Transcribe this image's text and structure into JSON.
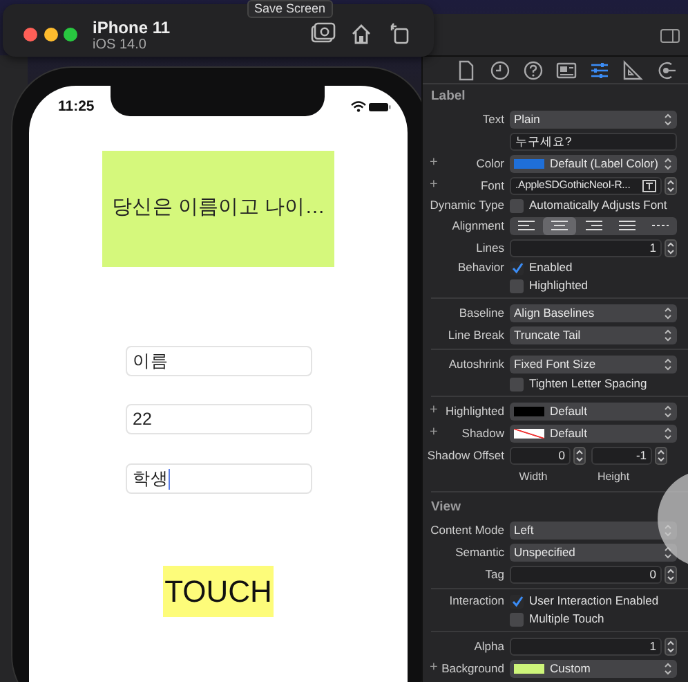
{
  "simulator": {
    "device": "iPhone 11",
    "os": "iOS 14.0",
    "tooltip": "Save Screen"
  },
  "phone": {
    "time": "11:25",
    "label": {
      "text": "당신은 이름이고 나이…",
      "color": "#d5f87c"
    },
    "fields": [
      {
        "value": "이름",
        "focused": false
      },
      {
        "value": "22",
        "focused": false
      },
      {
        "value": "학생",
        "focused": true
      }
    ],
    "button": {
      "label": "TOUCH",
      "color": "#fdfc7a"
    }
  },
  "inspector": {
    "tabs": [
      {
        "kind": "file",
        "selected": false
      },
      {
        "kind": "history",
        "selected": false
      },
      {
        "kind": "help",
        "selected": false
      },
      {
        "kind": "identity",
        "selected": false
      },
      {
        "kind": "attributes",
        "selected": true
      },
      {
        "kind": "size",
        "selected": false
      },
      {
        "kind": "connections",
        "selected": false
      }
    ],
    "sections": [
      {
        "title": "Label",
        "rows": [
          {
            "kind": "select",
            "label": "Text",
            "value": "Plain"
          },
          {
            "kind": "text",
            "value": "누구세요?"
          },
          {
            "kind": "select",
            "label": "Color",
            "value": "Default (Label Color)",
            "plus": "+",
            "swatch": {
              "kind": "color",
              "color": "#1f6fd8"
            }
          },
          {
            "kind": "font",
            "label": "Font",
            "value": ".AppleSDGothicNeoI-R...",
            "plus": "+"
          },
          {
            "kind": "check",
            "label": "Dynamic Type",
            "text": "Automatically Adjusts Font",
            "checked": false
          },
          {
            "kind": "segments",
            "label": "Alignment",
            "options": [
              {
                "kind": "left",
                "selected": false
              },
              {
                "kind": "center",
                "selected": true
              },
              {
                "kind": "right",
                "selected": false
              },
              {
                "kind": "justified",
                "selected": false
              },
              {
                "kind": "natural",
                "selected": false
              }
            ]
          },
          {
            "kind": "stepper",
            "label": "Lines",
            "value": "1"
          },
          {
            "kind": "check",
            "label": "Behavior",
            "text": "Enabled",
            "checked": true
          },
          {
            "kind": "check",
            "text": "Highlighted",
            "checked": false
          },
          {
            "kind": "divider"
          },
          {
            "kind": "select",
            "label": "Baseline",
            "value": "Align Baselines"
          },
          {
            "kind": "select",
            "label": "Line Break",
            "value": "Truncate Tail"
          },
          {
            "kind": "divider"
          },
          {
            "kind": "select",
            "label": "Autoshrink",
            "value": "Fixed Font Size"
          },
          {
            "kind": "check",
            "text": "Tighten Letter Spacing",
            "checked": false
          },
          {
            "kind": "divider"
          },
          {
            "kind": "select",
            "label": "Highlighted",
            "value": "Default",
            "plus": "+",
            "swatch": {
              "kind": "color",
              "color": "#000000"
            }
          },
          {
            "kind": "select",
            "label": "Shadow",
            "value": "Default",
            "plus": "+",
            "swatch": {
              "kind": "none"
            }
          },
          {
            "kind": "pair",
            "label": "Shadow Offset",
            "values": [
              "0",
              "-1"
            ],
            "captions": [
              "Width",
              "Height"
            ]
          }
        ]
      },
      {
        "title": "View",
        "rows": [
          {
            "kind": "select",
            "label": "Content Mode",
            "value": "Left"
          },
          {
            "kind": "select",
            "label": "Semantic",
            "value": "Unspecified"
          },
          {
            "kind": "stepper",
            "label": "Tag",
            "value": "0"
          },
          {
            "kind": "divider"
          },
          {
            "kind": "check",
            "label": "Interaction",
            "text": "User Interaction Enabled",
            "checked": true
          },
          {
            "kind": "check",
            "text": "Multiple Touch",
            "checked": false
          },
          {
            "kind": "divider"
          },
          {
            "kind": "stepper",
            "label": "Alpha",
            "value": "1"
          },
          {
            "kind": "select",
            "label": "Background",
            "value": "Custom",
            "plus": "+",
            "swatch": {
              "kind": "color",
              "color": "#cdf47a"
            }
          }
        ]
      }
    ]
  }
}
